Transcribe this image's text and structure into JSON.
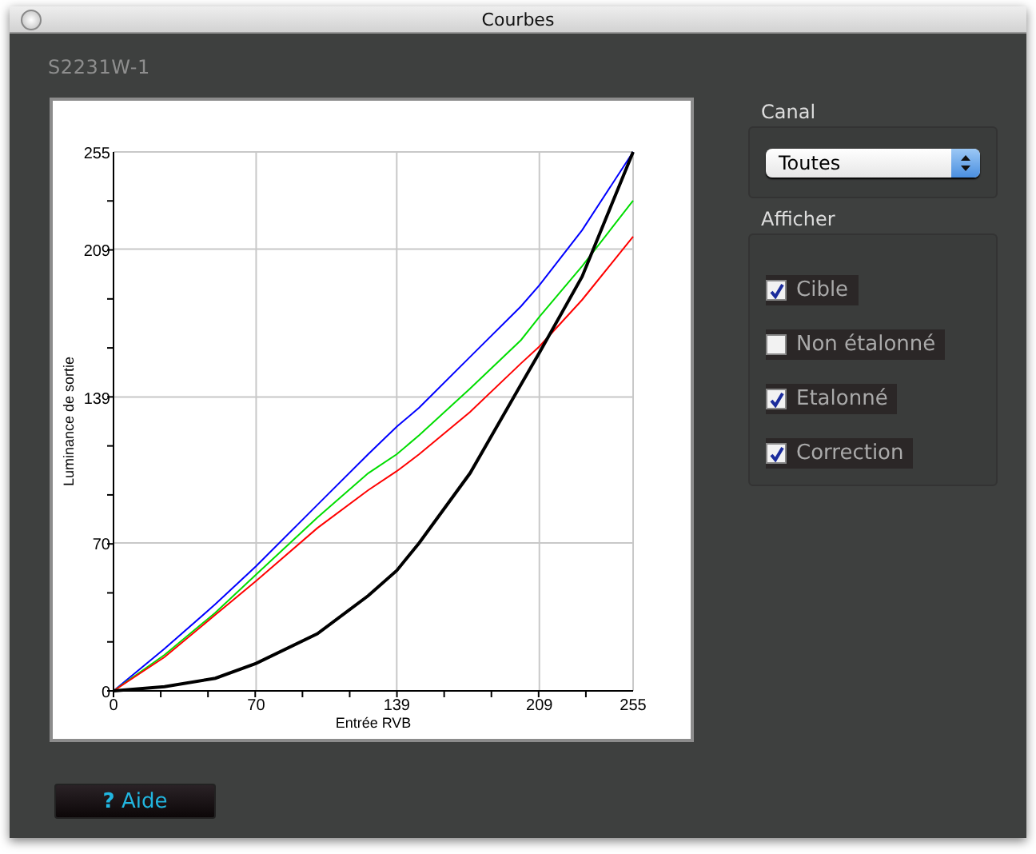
{
  "window": {
    "title": "Courbes"
  },
  "display_name": "S2231W-1",
  "chart": {
    "chart_data": {
      "type": "line",
      "grid": true,
      "xlabel": "Entrée RVB",
      "ylabel": "Luminance de sortie",
      "x": [
        0,
        25,
        50,
        70,
        100,
        125,
        139,
        150,
        175,
        200,
        209,
        230,
        255
      ],
      "xlim": [
        0,
        255
      ],
      "ylim": [
        0,
        255
      ],
      "xticks": [
        0,
        70,
        139,
        209,
        255
      ],
      "yticks": [
        0,
        70,
        139,
        209,
        255
      ],
      "series": [
        {
          "color": "#0000ff",
          "values": [
            0,
            20,
            41,
            59,
            88,
            112,
            125,
            134,
            158,
            182,
            192,
            218,
            255
          ]
        },
        {
          "color": "#00dd00",
          "values": [
            0,
            17,
            37,
            55,
            82,
            103,
            112,
            121,
            143,
            166,
            177,
            201,
            232
          ]
        },
        {
          "color": "#ff0000",
          "values": [
            0,
            16,
            36,
            52,
            77,
            95,
            104,
            112,
            132,
            155,
            163,
            185,
            215
          ]
        },
        {
          "color": "#000000",
          "values": [
            0,
            2,
            6,
            13,
            27,
            45,
            57,
            70,
            103,
            145,
            160,
            196,
            255
          ]
        }
      ]
    }
  },
  "canal": {
    "label": "Canal",
    "select": {
      "value": "Toutes"
    }
  },
  "afficher": {
    "label": "Afficher",
    "options": [
      {
        "label": "Cible",
        "checked": true
      },
      {
        "label": "Non étalonné",
        "checked": false
      },
      {
        "label": "Etalonné",
        "checked": true
      },
      {
        "label": "Correction",
        "checked": true
      }
    ]
  },
  "help_button": {
    "icon": "?",
    "label": "Aide"
  }
}
